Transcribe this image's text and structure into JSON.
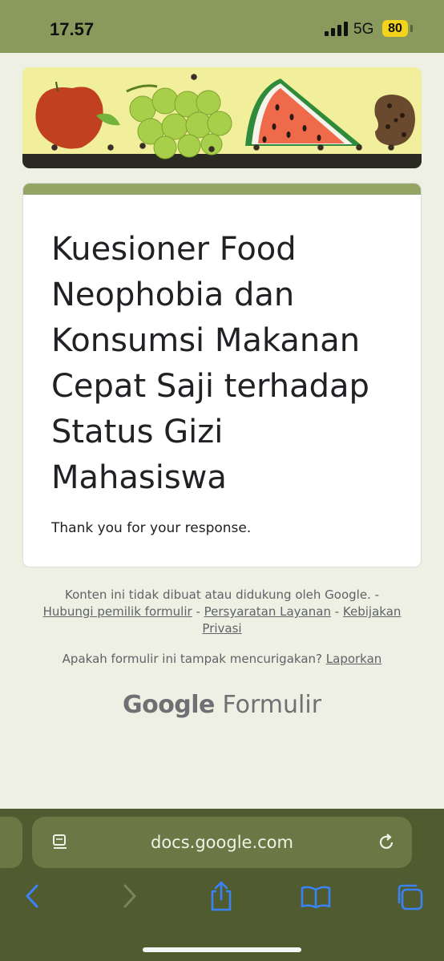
{
  "status_bar": {
    "time": "17.57",
    "network": "5G",
    "battery": "80"
  },
  "form": {
    "title": "Kuesioner Food Neophobia dan Konsumsi Makanan Cepat Saji terhadap Status Gizi Mahasiswa",
    "confirmation": "Thank you for your response."
  },
  "footer": {
    "disclaimer": "Konten ini tidak dibuat atau didukung oleh Google. -",
    "link_contact": "Hubungi pemilik formulir",
    "sep1": " - ",
    "link_terms": "Persyaratan Layanan",
    "sep2": " - ",
    "link_privacy": "Kebijakan Privasi",
    "report_question": "Apakah formulir ini tampak mencurigakan?",
    "report_link": "Laporkan",
    "brand_google": "Google",
    "brand_product": "Formulir"
  },
  "browser": {
    "url": "docs.google.com"
  },
  "colors": {
    "theme": "#94a566",
    "status_bar": "#8a9a5c",
    "toolbar": "#505b2f",
    "link_blue": "#3a82f6"
  },
  "icons": [
    "signal-icon",
    "battery-icon",
    "reader-icon",
    "reload-icon",
    "back-icon",
    "forward-icon",
    "share-icon",
    "bookmarks-icon",
    "tabs-icon"
  ]
}
